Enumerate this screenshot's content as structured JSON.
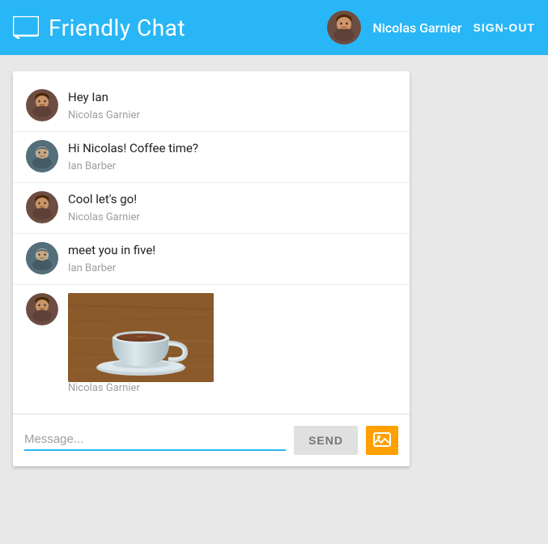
{
  "header": {
    "title": "Friendly Chat",
    "icon_label": "chat-icon",
    "user": {
      "name": "Nicolas Garnier",
      "sign_out_label": "SIGN-OUT"
    }
  },
  "messages": [
    {
      "id": "msg1",
      "text": "Hey Ian",
      "author": "Nicolas Garnier",
      "avatar_type": "ng",
      "has_image": false
    },
    {
      "id": "msg2",
      "text": "Hi Nicolas! Coffee time?",
      "author": "Ian Barber",
      "avatar_type": "ib",
      "has_image": false
    },
    {
      "id": "msg3",
      "text": "Cool let's go!",
      "author": "Nicolas Garnier",
      "avatar_type": "ng",
      "has_image": false
    },
    {
      "id": "msg4",
      "text": "meet you in five!",
      "author": "Ian Barber",
      "avatar_type": "ib",
      "has_image": false
    },
    {
      "id": "msg5",
      "text": "",
      "author": "Nicolas Garnier",
      "avatar_type": "ng",
      "has_image": true
    }
  ],
  "input": {
    "placeholder": "Message...",
    "send_label": "SEND",
    "image_icon": "image-icon"
  },
  "colors": {
    "header_bg": "#29b6f6",
    "send_btn_bg": "#e0e0e0",
    "image_btn_bg": "#ffa000",
    "input_underline": "#29b6f6"
  }
}
